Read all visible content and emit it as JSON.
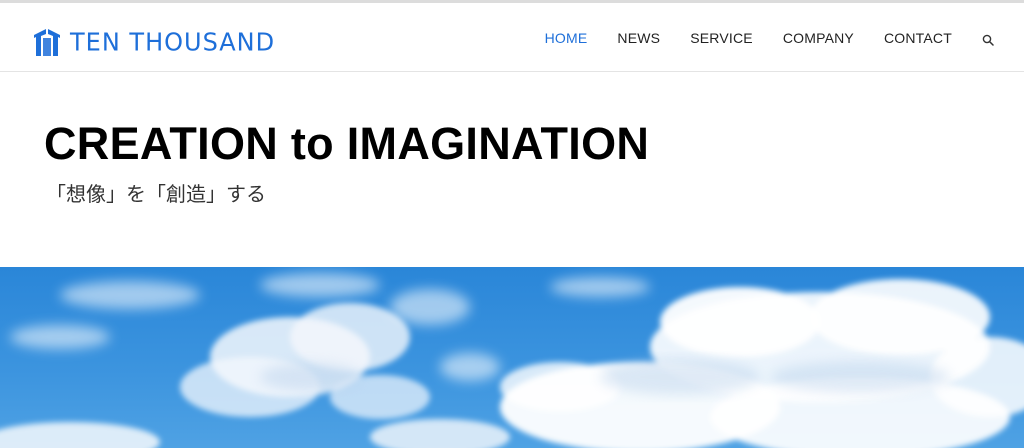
{
  "brand": {
    "logo_text": "TEN THOUSAND",
    "accent_color": "#1e6fd9"
  },
  "nav": {
    "items": [
      {
        "label": "HOME",
        "active": true
      },
      {
        "label": "NEWS",
        "active": false
      },
      {
        "label": "SERVICE",
        "active": false
      },
      {
        "label": "COMPANY",
        "active": false
      },
      {
        "label": "CONTACT",
        "active": false
      }
    ],
    "search_icon": "search-icon"
  },
  "hero": {
    "headline": "CREATION to IMAGINATION",
    "subheadline": "「想像」を「創造」する"
  },
  "banner": {
    "image": "blue-sky-with-clouds"
  }
}
